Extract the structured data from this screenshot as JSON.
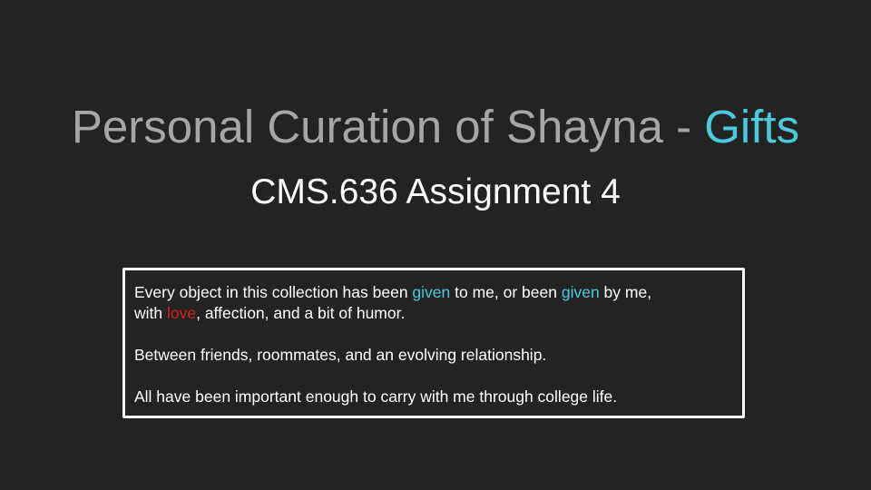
{
  "title": {
    "main": "Personal Curation of Shayna - ",
    "accent": "Gifts"
  },
  "subtitle": "CMS.636 Assignment 4",
  "body": {
    "p1": {
      "s1": "Every object in this collection has been ",
      "given1": "given",
      "s2": " to me, or been ",
      "given2": "given",
      "s3": " by me,",
      "s4": "with ",
      "love": "love",
      "s5": ", affection, and a bit of humor."
    },
    "p2": "Between friends, roommates, and an evolving relationship.",
    "p3": "All have been important enough to carry with me through college life."
  },
  "colors": {
    "background": "#232323",
    "title_gray": "#a6a6a6",
    "accent_cyan": "#4cc9dc",
    "accent_red": "#d3231c",
    "text_white": "#ffffff"
  }
}
